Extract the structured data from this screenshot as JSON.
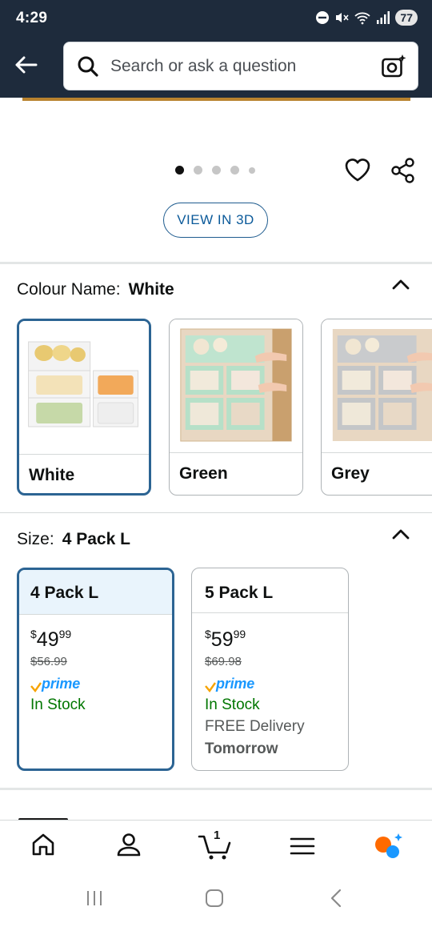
{
  "status_bar": {
    "time": "4:29",
    "battery": "77"
  },
  "search": {
    "placeholder": "Search or ask a question"
  },
  "carousel": {
    "dot_count": 5,
    "active_index": 0
  },
  "view_3d": {
    "label": "VIEW IN 3D"
  },
  "colour": {
    "label": "Colour Name:",
    "selected": "White",
    "options": [
      {
        "label": "White",
        "selected": true
      },
      {
        "label": "Green",
        "selected": false
      },
      {
        "label": "Grey",
        "selected": false
      }
    ]
  },
  "size": {
    "label": "Size:",
    "selected": "4 Pack L",
    "options": [
      {
        "label": "4 Pack L",
        "currency": "$",
        "price_whole": "49",
        "price_fraction": "99",
        "was_price": "$56.99",
        "prime": "prime",
        "stock": "In Stock",
        "selected": true
      },
      {
        "label": "5 Pack L",
        "currency": "$",
        "price_whole": "59",
        "price_fraction": "99",
        "was_price": "$69.98",
        "prime": "prime",
        "stock": "In Stock",
        "delivery": "FREE Delivery",
        "delivery_day": "Tomorrow",
        "selected": false
      }
    ]
  },
  "cart": {
    "count": "1"
  },
  "colors": {
    "header_bg": "#1e2b3c",
    "selected_border": "#2c6493",
    "in_stock": "#007600",
    "prime_blue": "#1a98ff",
    "link_blue": "#0b5a9a"
  }
}
